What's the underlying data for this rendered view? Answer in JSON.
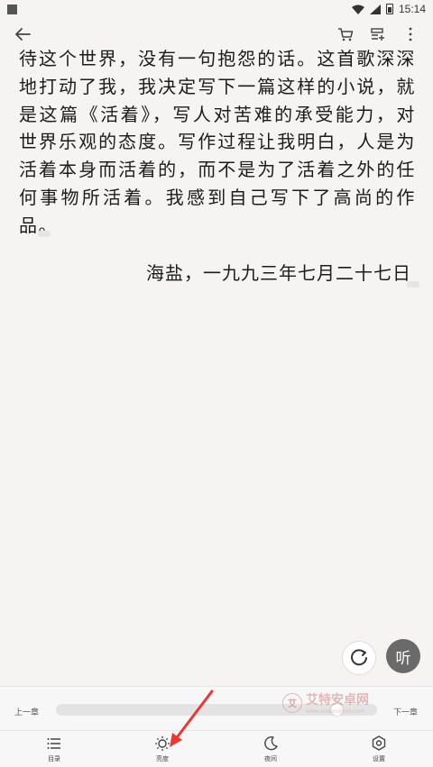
{
  "status_bar": {
    "time": "15:14"
  },
  "toolbar": {
    "icons": [
      "back-arrow-icon",
      "cart-icon",
      "add-bookshelf-icon",
      "more-vertical-icon"
    ]
  },
  "reader": {
    "paragraph": "待这个世界，没有一句抱怨的话。这首歌深深地打动了我，我决定写下一篇这样的小说，就是这篇《活着》，写人对苦难的承受能力，对世界乐观的态度。写作过程让我明白，人是为活着本身而活着的，而不是为了活着之外的任何事物所活着。我感到自己写下了高尚的作品。",
    "signature": "海盐，一九九三年七月二十七日"
  },
  "floating": {
    "listen_label": "听"
  },
  "bottom": {
    "prev_chapter": "上一章",
    "next_chapter": "下一章",
    "progress": 0.89,
    "watermark_text": "艾特安卓网",
    "watermark_sub": "www.aiteandroid.com",
    "tabs": [
      {
        "label": "目录",
        "icon": "catalog-icon"
      },
      {
        "label": "亮度",
        "icon": "brightness-icon"
      },
      {
        "label": "夜间",
        "icon": "night-mode-icon"
      },
      {
        "label": "设置",
        "icon": "settings-icon"
      }
    ]
  },
  "colors": {
    "background": "#f5f4f2",
    "text": "#1c1c1c",
    "annotation_arrow": "#e53935",
    "listen_button": "#6a6a6a"
  }
}
